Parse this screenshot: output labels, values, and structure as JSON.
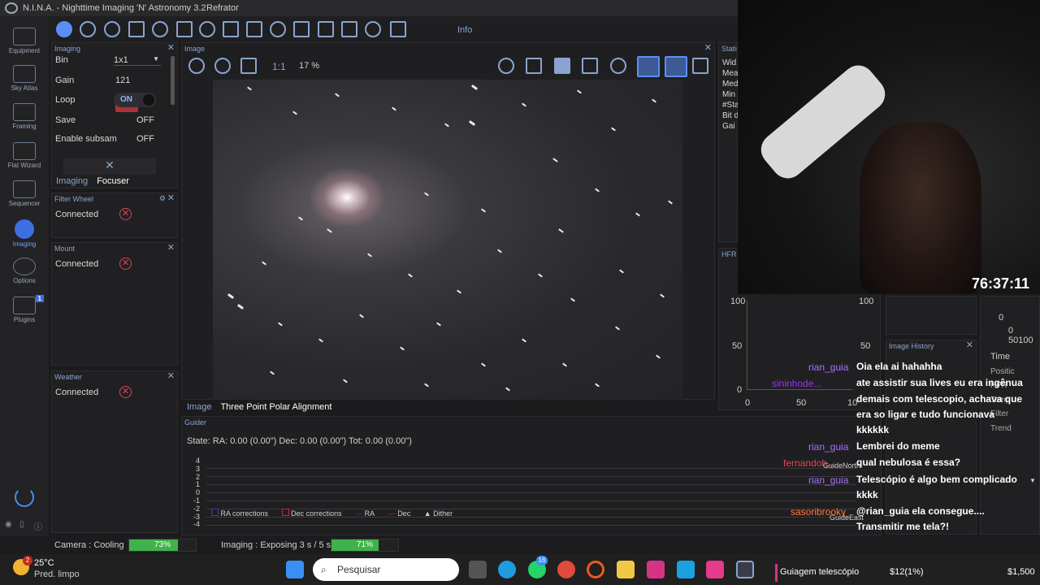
{
  "window": {
    "title": "N.I.N.A. - Nighttime Imaging 'N' Astronomy 3.2",
    "profile": "Refrator"
  },
  "nav": [
    {
      "label": "Equipment"
    },
    {
      "label": "Sky Atlas"
    },
    {
      "label": "Framing"
    },
    {
      "label": "Flat Wizard"
    },
    {
      "label": "Sequencer"
    },
    {
      "label": "Imaging"
    },
    {
      "label": "Options"
    },
    {
      "label": "Plugins",
      "badge": "1"
    }
  ],
  "nav_collapse": "< <",
  "toolbar": {
    "info_label": "Info"
  },
  "imaging_panel": {
    "title": "Imaging",
    "rows": {
      "bin_label": "Bin",
      "bin_value": "1x1",
      "gain_label": "Gain",
      "gain_value": "121",
      "loop_label": "Loop",
      "loop_value": "ON",
      "save_label": "Save",
      "save_value": "OFF",
      "subsam_label": "Enable subsam",
      "subsam_value": "OFF"
    },
    "tabs": [
      "Imaging",
      "Focuser"
    ]
  },
  "filter_wheel": {
    "title": "Filter Wheel",
    "status": "Connected"
  },
  "mount": {
    "title": "Mount",
    "status": "Connected"
  },
  "weather": {
    "title": "Weather",
    "status": "Connected"
  },
  "image_panel": {
    "title": "Image",
    "one_to_one": "1:1",
    "zoom": "17 %",
    "tabs": [
      "Image",
      "Three Point Polar Alignment"
    ]
  },
  "statistics": {
    "title": "Statisti",
    "rows": [
      "Wid",
      "Mea",
      "Med",
      "Min",
      "#Sta",
      "Bit d",
      "Gai"
    ]
  },
  "hfr": {
    "title": "HFR h",
    "y_ticks": [
      "100",
      "50",
      "0"
    ],
    "x_ticks": [
      "0",
      "50",
      "10"
    ],
    "right_ticks": [
      "100",
      "50"
    ]
  },
  "image_history": {
    "title": "Image History",
    "fields": [
      "Time",
      "Positic",
      "HFR",
      "Temp",
      "Filter",
      "Trend"
    ],
    "values_top": "0",
    "values_axis": "0 50100"
  },
  "guider": {
    "title": "Guider",
    "state": "State:  RA: 0.00 (0.00\")  Dec: 0.00 (0.00\")  Tot: 0.00 (0.00\")",
    "y_ticks": [
      "4",
      "3",
      "2",
      "1",
      "0",
      "-1",
      "-2",
      "-3",
      "-4"
    ],
    "legend": [
      "RA corrections",
      "Dec corrections",
      "RA",
      "Dec",
      "Dither"
    ],
    "north": "GuideNorth",
    "east": "GuideEast"
  },
  "status_bar": {
    "camera_label": "Camera :",
    "camera_status": "Cooling",
    "camera_progress": 73,
    "camera_progress_text": "73%",
    "imaging_label": "Imaging :",
    "imaging_status": "Exposing 3 s / 5 s",
    "imaging_progress": 71,
    "imaging_progress_text": "71%"
  },
  "stream": {
    "timer": "76:37:11",
    "chat": [
      {
        "user": "rian_guia",
        "user_color": "#a970ff",
        "text": "Oia ela ai hahahha"
      },
      {
        "user": "sininhode...",
        "user_color": "#9b30ff",
        "text": "ate assistir sua lives eu era ingênua"
      },
      {
        "user": "",
        "user_color": "",
        "text": "demais com telescopio, achava que"
      },
      {
        "user": "",
        "user_color": "",
        "text": "era so ligar e tudo funcionava"
      },
      {
        "user": "",
        "user_color": "",
        "text": "kkkkkk"
      },
      {
        "user": "rian_guia",
        "user_color": "#a970ff",
        "text": "Lembrei do meme"
      },
      {
        "user": "fernandoh...",
        "user_color": "#e0455a",
        "text": "qual nebulosa é essa?"
      },
      {
        "user": "rian_guia",
        "user_color": "#a970ff",
        "text": "Telescópio é algo bem complicado"
      },
      {
        "user": "",
        "user_color": "",
        "text": "kkkk"
      },
      {
        "user": "sasoribrooky",
        "user_color": "#ff7a3d",
        "text": "@rian_guia ela consegue...."
      },
      {
        "user": "",
        "user_color": "",
        "text": "Transmitir me tela?!"
      }
    ],
    "ticker": {
      "goal": "Guiagem telescópio",
      "amount": "$12(1%)",
      "total": "$1,500"
    }
  },
  "taskbar": {
    "weather_temp": "25°C",
    "weather_desc": "Pred. limpo",
    "weather_badge": "2",
    "search_placeholder": "Pesquisar",
    "whatsapp_badge": "16"
  }
}
